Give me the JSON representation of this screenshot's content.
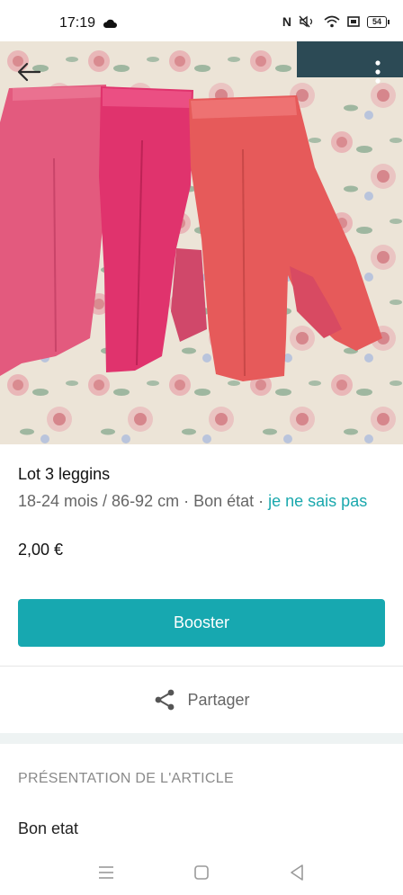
{
  "status_bar": {
    "time": "17:19",
    "icons": [
      "cloud-icon",
      "nfc-icon",
      "mute-icon",
      "wifi-icon",
      "screen-icon",
      "battery-icon"
    ],
    "battery": "54"
  },
  "photo": {
    "subject": "three pink leggings on floral bedsheet",
    "colors": {
      "leggings_light": "#e35a7e",
      "leggings_bright": "#e0336d",
      "leggings_coral": "#e65a5a",
      "sheet": "#ece4d7"
    }
  },
  "item": {
    "title": "Lot 3 leggins",
    "size": "18-24 mois / 86-92 cm",
    "separator": " · ",
    "condition": "Bon état",
    "brand_link": "je ne sais pas",
    "price": "2,00 €"
  },
  "actions": {
    "boost_label": "Booster",
    "share_label": "Partager"
  },
  "section": {
    "header": "PRÉSENTATION DE L'ARTICLE",
    "description": "Bon etat"
  },
  "colors": {
    "accent": "#17a8b0",
    "link": "#1aa8ad",
    "secondary_text": "#666666"
  }
}
